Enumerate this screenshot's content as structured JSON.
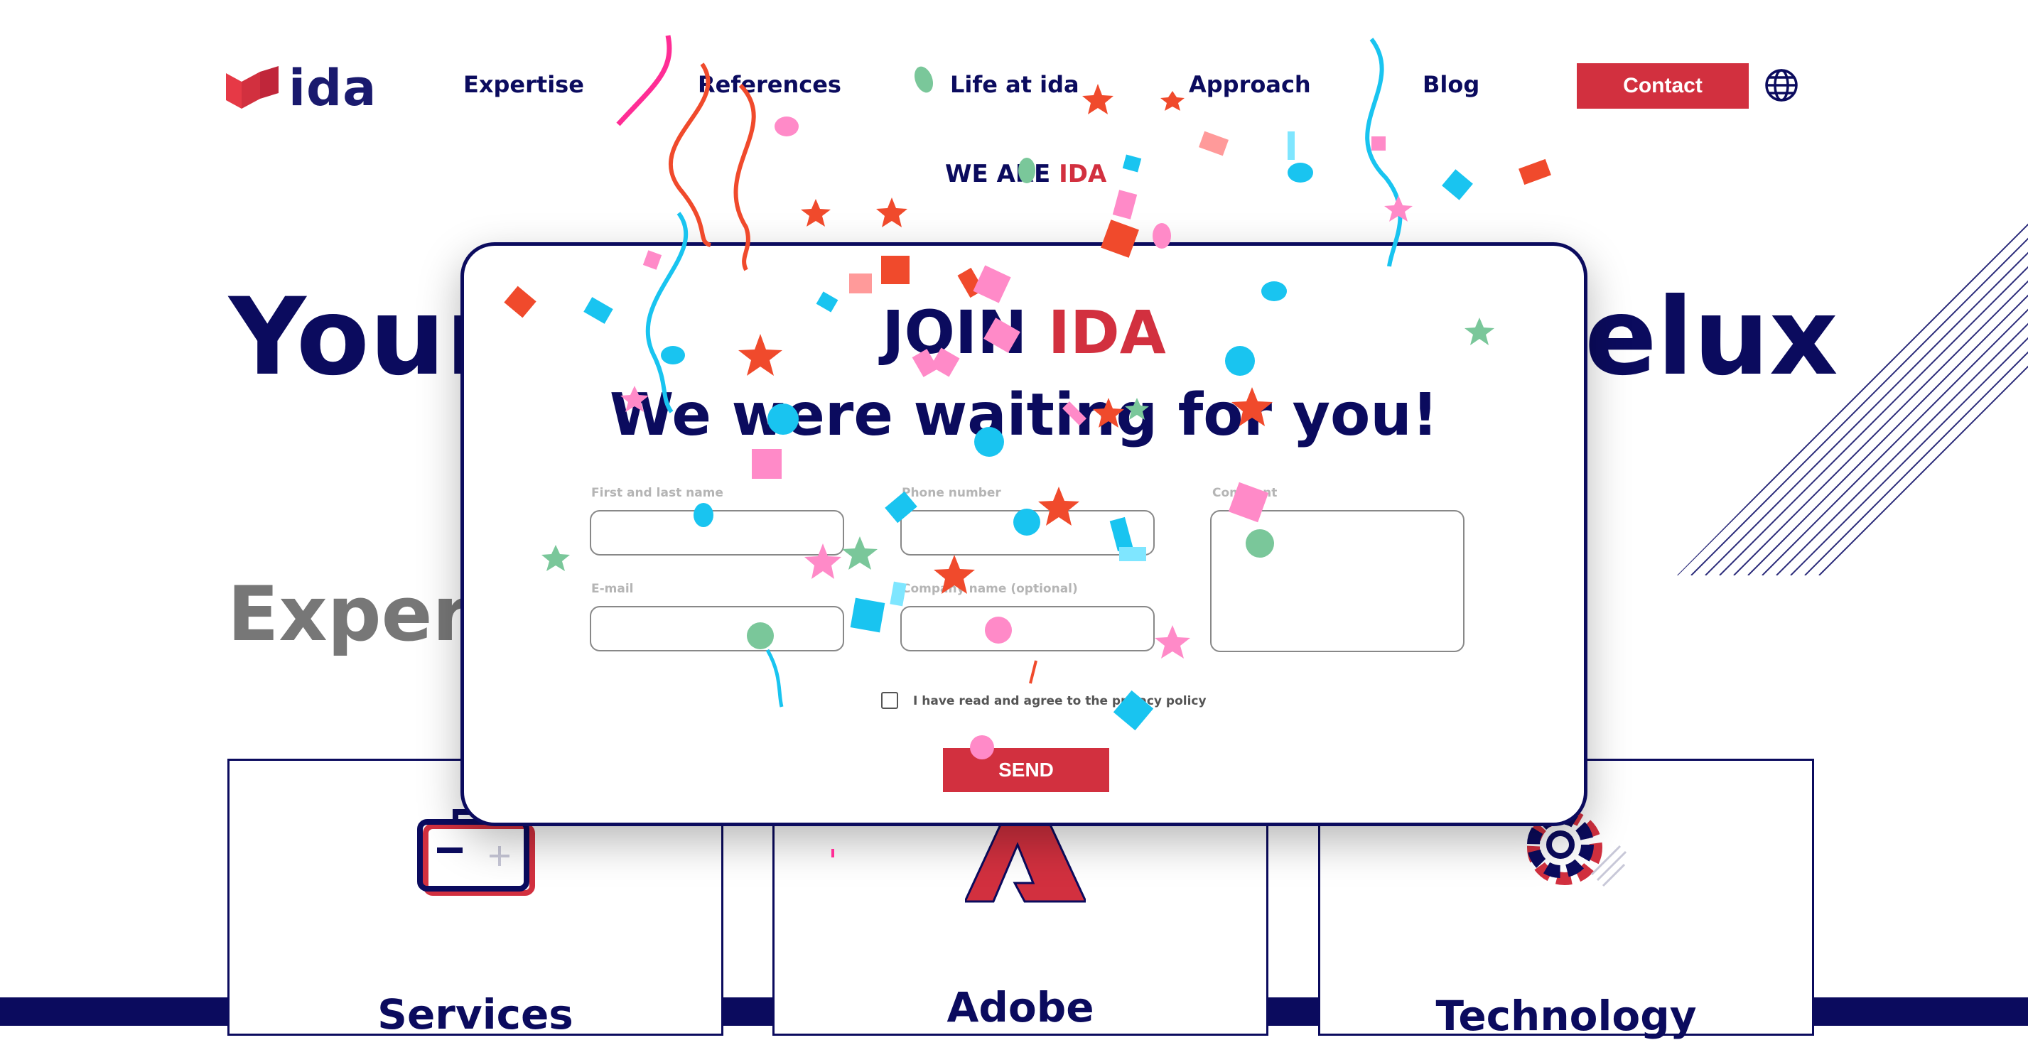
{
  "header": {
    "logo_text": "ida",
    "nav": [
      "Expertise",
      "References",
      "Life at ida",
      "Approach",
      "Blog"
    ],
    "contact_label": "Contact",
    "tagline_prefix": "WE ARE ",
    "tagline_accent": "IDA"
  },
  "hero": {
    "headline_left": "Your",
    "headline_right": "elux",
    "subheadline_left": "Expert"
  },
  "cards": [
    {
      "title": "Services"
    },
    {
      "title": "Adobe"
    },
    {
      "title": "Technology"
    }
  ],
  "modal": {
    "title_prefix": "JOIN ",
    "title_accent": "IDA",
    "subtitle": "We were waiting for you!",
    "fields": {
      "name_label": "First and last name",
      "phone_label": "Phone number",
      "comment_label": "Comment",
      "email_label": "E-mail",
      "company_label": "Company name (optional)"
    },
    "consent_text": "I have read and agree to the privacy policy",
    "send_label": "SEND"
  },
  "colors": {
    "navy": "#0b0b5e",
    "brand_red": "#d2303f",
    "gray": "#777777"
  },
  "icons": [
    "logo-mark-icon",
    "globe-icon",
    "briefcase-icon",
    "adobe-icon",
    "gear-icon"
  ]
}
